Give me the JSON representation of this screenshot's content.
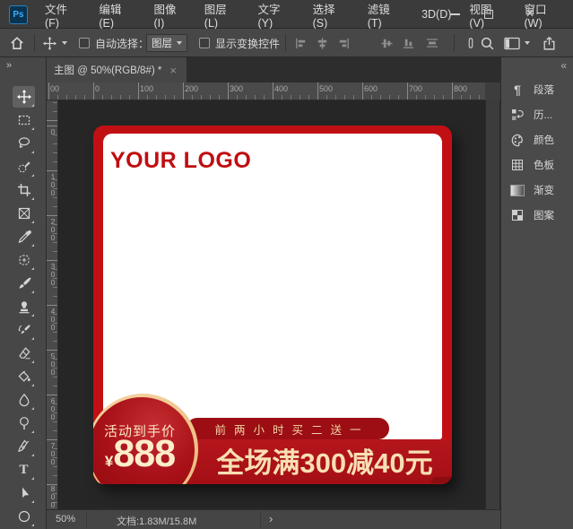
{
  "window": {
    "app_badge": "Ps",
    "menus": [
      "文件(F)",
      "编辑(E)",
      "图像(I)",
      "图层(L)",
      "文字(Y)",
      "选择(S)",
      "滤镜(T)",
      "3D(D)",
      "视图(V)",
      "窗口(W)"
    ],
    "close_glyph": "×"
  },
  "options": {
    "auto_select_label": "自动选择：",
    "auto_select_value": "图层",
    "show_transform_label": "显示变换控件",
    "icons": [
      "home-icon",
      "move-icon",
      "align-left-icon",
      "align-h-center-icon",
      "align-right-icon",
      "align-v-center-icon",
      "align-bottom-icon",
      "distribute-icon",
      "measure-icon",
      "search-icon",
      "workspace-icon",
      "share-icon"
    ]
  },
  "tabs": {
    "active": {
      "title": "主图 @ 50%(RGB/8#) *",
      "close_glyph": "×"
    }
  },
  "toolbar": {
    "collapse_glyph": "»",
    "type_tool_glyph": "T",
    "tools": [
      "move",
      "rectangular-marquee",
      "lasso",
      "quick-selection",
      "crop",
      "frame",
      "eyedropper",
      "healing-brush",
      "brush",
      "clone-stamp",
      "history-brush",
      "eraser",
      "paint-bucket",
      "blur",
      "dodge",
      "pen",
      "type",
      "path-selection",
      "ellipse"
    ]
  },
  "rulers": {
    "horizontal": [
      "00",
      "0",
      "100",
      "200",
      "300",
      "400",
      "500",
      "600",
      "700",
      "800"
    ],
    "vertical": [
      "0",
      "100",
      "200",
      "300",
      "400",
      "500",
      "600",
      "700",
      "800"
    ]
  },
  "canvas": {
    "logo_text": "YOUR LOGO",
    "badge_label": "活动到手价",
    "badge_currency": "¥",
    "badge_price": "888",
    "ribbon_text": "前两小时买二送一",
    "promo_text": "全场满300减40元",
    "colors": {
      "frame_red": "#c11014",
      "bar_red": "#b0151b",
      "ribbon_red": "#9c0e13",
      "cream_text": "#f8dfb4",
      "gold_rim": "#f4cf9c"
    }
  },
  "panels": {
    "collapse_glyph": "«",
    "paragraph_glyph": "¶",
    "items": [
      {
        "icon": "paragraph-icon",
        "label": "段落"
      },
      {
        "icon": "history-icon",
        "label": "历..."
      },
      {
        "icon": "color-icon",
        "label": "颜色"
      },
      {
        "icon": "swatches-icon",
        "label": "色板"
      },
      {
        "icon": "gradient-icon",
        "label": "渐变"
      },
      {
        "icon": "pattern-icon",
        "label": "图案"
      }
    ]
  },
  "status": {
    "zoom": "50%",
    "document_info": "文档:1.83M/15.8M",
    "chevron": "›"
  }
}
